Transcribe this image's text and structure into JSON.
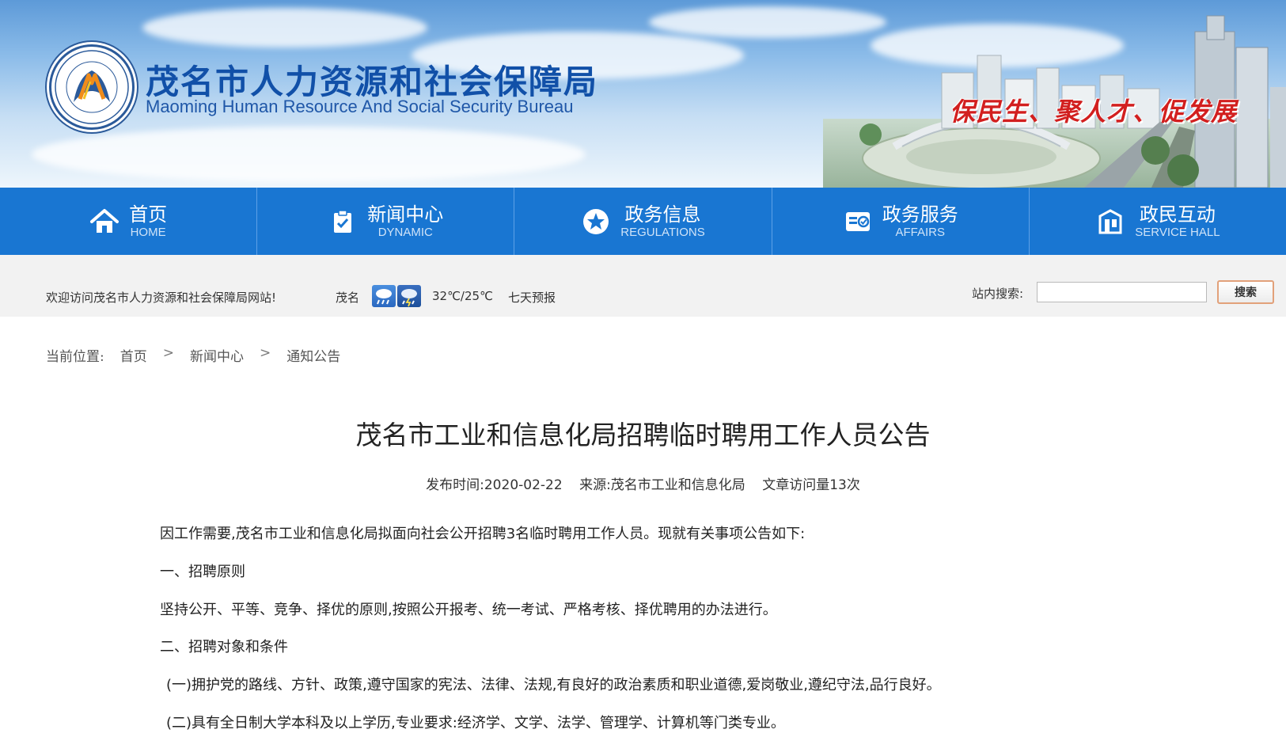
{
  "header": {
    "title_cn": "茂名市人力资源和社会保障局",
    "title_en": "Maoming Human Resource And Social Security Bureau",
    "slogan": "保民生、聚人才、促发展"
  },
  "nav": {
    "items": [
      {
        "cn": "首页",
        "en": "HOME",
        "icon": "home-icon"
      },
      {
        "cn": "新闻中心",
        "en": "DYNAMIC",
        "icon": "clipboard-check-icon"
      },
      {
        "cn": "政务信息",
        "en": "REGULATIONS",
        "icon": "star-badge-icon"
      },
      {
        "cn": "政务服务",
        "en": "AFFAIRS",
        "icon": "service-card-icon"
      },
      {
        "cn": "政民互动",
        "en": "SERVICE HALL",
        "icon": "building-icon"
      }
    ]
  },
  "infobar": {
    "welcome": "欢迎访问茂名市人力资源和社会保障局网站!",
    "city": "茂名",
    "weather_icons": [
      "rain-icon",
      "thunderstorm-icon"
    ],
    "temperature": "32℃/25℃",
    "forecast_link": "七天预报",
    "search_label": "站内搜索:",
    "search_value": "",
    "search_button": "搜索"
  },
  "breadcrumb": {
    "label": "当前位置:",
    "items": [
      "首页",
      "新闻中心",
      "通知公告"
    ],
    "separator": ">"
  },
  "article": {
    "title": "茂名市工业和信息化局招聘临时聘用工作人员公告",
    "publish_time": "发布时间:2020-02-22",
    "source": "来源:茂名市工业和信息化局",
    "views": "文章访问量13次",
    "paragraphs": [
      "因工作需要,茂名市工业和信息化局拟面向社会公开招聘3名临时聘用工作人员。现就有关事项公告如下:",
      "一、招聘原则",
      "坚持公开、平等、竞争、择优的原则,按照公开报考、统一考试、严格考核、择优聘用的办法进行。",
      "二、招聘对象和条件",
      "(一)拥护党的路线、方针、政策,遵守国家的宪法、法律、法规,有良好的政治素质和职业道德,爱岗敬业,遵纪守法,品行良好。",
      "(二)具有全日制大学本科及以上学历,专业要求:经济学、文学、法学、管理学、计算机等门类专业。"
    ]
  },
  "colors": {
    "nav_bg": "#1976d2",
    "title_blue": "#1150a8",
    "slogan_red": "#d21f1f"
  }
}
